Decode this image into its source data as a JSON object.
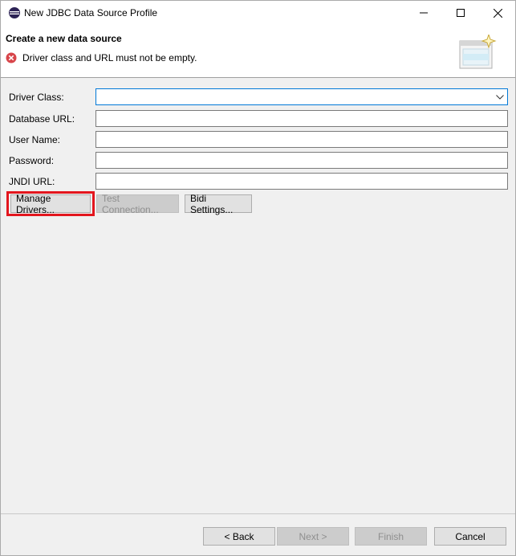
{
  "window": {
    "title": "New JDBC Data Source Profile",
    "icons": {
      "app": "eclipse-icon",
      "minimize": "minimize-icon",
      "maximize": "maximize-icon",
      "close": "close-icon"
    }
  },
  "banner": {
    "title": "Create a new data source",
    "message": "Driver class and URL must not be empty.",
    "message_icon": "error-icon",
    "graphic": "new-window-wizard-graphic"
  },
  "form": {
    "driver_class_label": "Driver Class:",
    "driver_class_value": "",
    "database_url_label": "Database URL:",
    "database_url_value": "",
    "user_name_label": "User Name:",
    "user_name_value": "",
    "password_label": "Password:",
    "password_value": "",
    "jndi_url_label": "JNDI URL:",
    "jndi_url_value": ""
  },
  "actions": {
    "manage_drivers": "Manage Drivers...",
    "test_connection": "Test Connection...",
    "bidi_settings": "Bidi Settings..."
  },
  "footer": {
    "back": "< Back",
    "next": "Next >",
    "finish": "Finish",
    "cancel": "Cancel"
  },
  "colors": {
    "highlight": "#e3161e",
    "error": "#d8454a",
    "focus_border": "#0078d7"
  }
}
